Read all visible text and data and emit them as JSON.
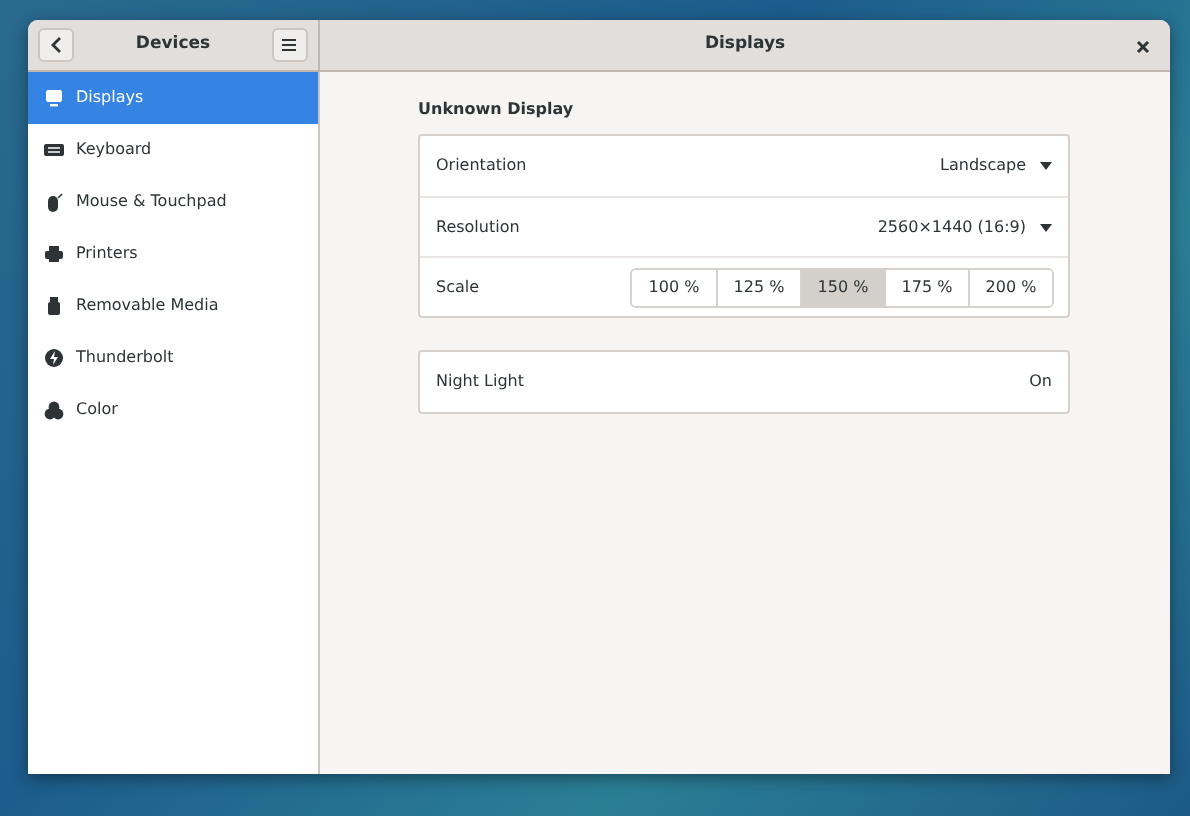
{
  "window": {
    "title": "Displays",
    "sidebar_title": "Devices"
  },
  "sidebar": {
    "items": [
      {
        "label": "Displays",
        "selected": true,
        "kind": "display"
      },
      {
        "label": "Keyboard",
        "selected": false,
        "kind": "keyboard"
      },
      {
        "label": "Mouse & Touchpad",
        "selected": false,
        "kind": "mouse"
      },
      {
        "label": "Printers",
        "selected": false,
        "kind": "printer"
      },
      {
        "label": "Removable Media",
        "selected": false,
        "kind": "media"
      },
      {
        "label": "Thunderbolt",
        "selected": false,
        "kind": "thunderbolt"
      },
      {
        "label": "Color",
        "selected": false,
        "kind": "color"
      }
    ]
  },
  "display": {
    "title": "Unknown Display",
    "rows": [
      {
        "kind": "dropdown",
        "label": "Orientation",
        "value": "Landscape"
      },
      {
        "kind": "dropdown",
        "label": "Resolution",
        "value": "2560×1440 (16:9)"
      },
      {
        "kind": "segments",
        "label": "Scale",
        "options": [
          {
            "label": "100 %",
            "selected": false
          },
          {
            "label": "125 %",
            "selected": false
          },
          {
            "label": "150 %",
            "selected": true
          },
          {
            "label": "175 %",
            "selected": false
          },
          {
            "label": "200 %",
            "selected": false
          }
        ]
      }
    ]
  },
  "night_light": {
    "label": "Night Light",
    "value": "On"
  }
}
